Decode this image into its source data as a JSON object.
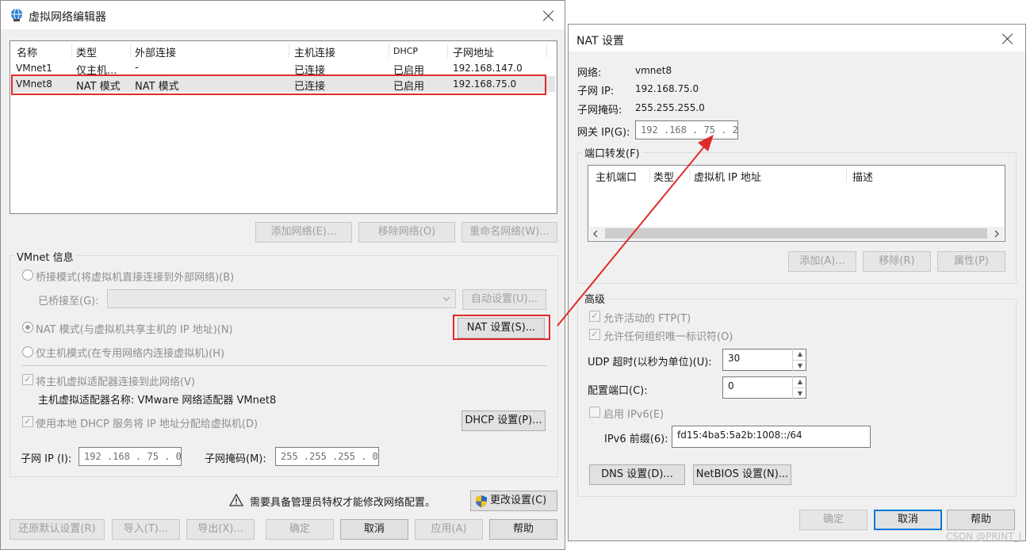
{
  "left_dialog": {
    "title": "虚拟网络编辑器",
    "columns": [
      "名称",
      "类型",
      "外部连接",
      "主机连接",
      "DHCP",
      "子网地址"
    ],
    "rows": [
      {
        "name": "VMnet1",
        "type": "仅主机...",
        "external": "-",
        "host": "已连接",
        "dhcp": "已启用",
        "subnet": "192.168.147.0"
      },
      {
        "name": "VMnet8",
        "type": "NAT 模式",
        "external": "NAT 模式",
        "host": "已连接",
        "dhcp": "已启用",
        "subnet": "192.168.75.0"
      }
    ],
    "add_network": "添加网络(E)...",
    "remove_network": "移除网络(O)",
    "rename_network": "重命名网络(W)...",
    "vmnet_info": "VMnet 信息",
    "bridge_mode": "桥接模式(将虚拟机直接连接到外部网络)(B)",
    "bridged_to": "已桥接至(G):",
    "auto_settings": "自动设置(U)...",
    "nat_mode": "NAT 模式(与虚拟机共享主机的 IP 地址)(N)",
    "nat_settings": "NAT 设置(S)...",
    "host_only": "仅主机模式(在专用网络内连接虚拟机)(H)",
    "connect_adapter": "将主机虚拟适配器连接到此网络(V)",
    "adapter_name": "主机虚拟适配器名称: VMware 网络适配器 VMnet8",
    "use_dhcp": "使用本地 DHCP 服务将 IP 地址分配给虚拟机(D)",
    "dhcp_settings": "DHCP 设置(P)...",
    "subnet_ip_label": "子网 IP (I):",
    "subnet_ip": "192 .168 . 75 .  0",
    "subnet_mask_label": "子网掩码(M):",
    "subnet_mask": "255 .255 .255 .  0",
    "admin_notice": "需要具备管理员特权才能修改网络配置。",
    "change_settings": "更改设置(C)",
    "restore_defaults": "还原默认设置(R)",
    "import": "导入(T)...",
    "export": "导出(X)...",
    "ok": "确定",
    "cancel": "取消",
    "apply": "应用(A)",
    "help": "帮助"
  },
  "nat_dialog": {
    "title": "NAT 设置",
    "network_label": "网络:",
    "network": "vmnet8",
    "subnet_ip_label": "子网 IP:",
    "subnet_ip": "192.168.75.0",
    "subnet_mask_label": "子网掩码:",
    "subnet_mask": "255.255.255.0",
    "gateway_label": "网关 IP(G):",
    "gateway": "192 .168 . 75 .  2",
    "port_forwarding": "端口转发(F)",
    "pf_columns": [
      "主机端口",
      "类型",
      "虚拟机 IP 地址",
      "描述"
    ],
    "pf_add": "添加(A)...",
    "pf_remove": "移除(R)",
    "pf_props": "属性(P)",
    "advanced": "高级",
    "allow_ftp": "允许活动的 FTP(T)",
    "allow_oui": "允许任何组织唯一标识符(O)",
    "udp_timeout_label": "UDP 超时(以秒为单位)(U):",
    "udp_timeout": "30",
    "config_port_label": "配置端口(C):",
    "config_port": "0",
    "enable_ipv6": "启用 IPv6(E)",
    "ipv6_prefix_label": "IPv6 前缀(6):",
    "ipv6_prefix": "fd15:4ba5:5a2b:1008::/64",
    "dns_settings": "DNS 设置(D)...",
    "netbios_settings": "NetBIOS 设置(N)...",
    "ok": "确定",
    "cancel": "取消",
    "help": "帮助"
  },
  "watermark": "CSDN @PRINT_I",
  "colors": {
    "annotation_red": "#e02b2b",
    "focus_blue": "#0078d7"
  }
}
